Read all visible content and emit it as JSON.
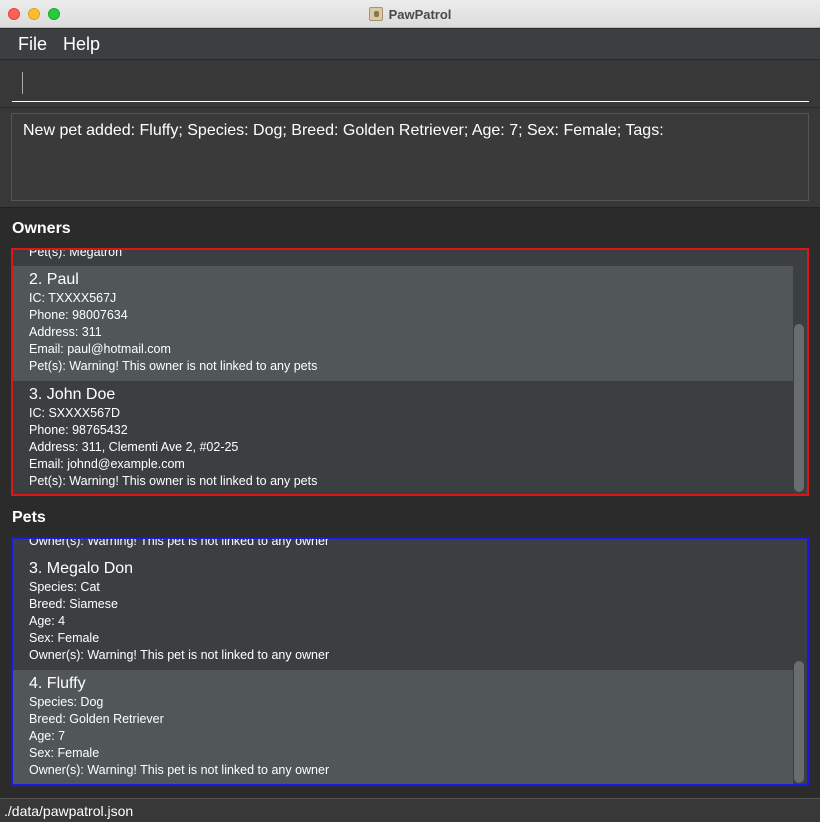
{
  "window": {
    "title": "PawPatrol"
  },
  "menu": {
    "file": "File",
    "help": "Help"
  },
  "command": {
    "value": ""
  },
  "result": {
    "text": "New pet added: Fluffy; Species: Dog; Breed: Golden Retriever; Age: 7; Sex: Female; Tags:"
  },
  "owners": {
    "label": "Owners",
    "partial_top": "Pet(s): Megatron",
    "cards": [
      {
        "name": "2.  Paul",
        "ic": "IC: TXXXX567J",
        "phone": "Phone: 98007634",
        "address": "Address: 311",
        "email": "Email: paul@hotmail.com",
        "pets": "Pet(s): Warning! This owner is not linked to any pets"
      },
      {
        "name": "3.  John Doe",
        "ic": "IC: SXXXX567D",
        "phone": "Phone: 98765432",
        "address": "Address: 311, Clementi Ave 2, #02-25",
        "email": "Email: johnd@example.com",
        "pets": "Pet(s): Warning! This owner is not linked to any pets"
      }
    ]
  },
  "pets": {
    "label": "Pets",
    "partial_top": "Owner(s): Warning! This pet is not linked to any owner",
    "cards": [
      {
        "name": "3.  Megalo Don",
        "species": "Species: Cat",
        "breed": "Breed: Siamese",
        "age": "Age: 4",
        "sex": "Sex: Female",
        "owners": "Owner(s): Warning! This pet is not linked to any owner"
      },
      {
        "name": "4.  Fluffy",
        "species": "Species: Dog",
        "breed": "Breed: Golden Retriever",
        "age": "Age: 7",
        "sex": "Sex: Female",
        "owners": "Owner(s): Warning! This pet is not linked to any owner"
      }
    ]
  },
  "status": {
    "path": "./data/pawpatrol.json"
  },
  "colors": {
    "owners_border": "#e01414",
    "pets_border": "#1818e8",
    "selected_card": "#515658"
  }
}
